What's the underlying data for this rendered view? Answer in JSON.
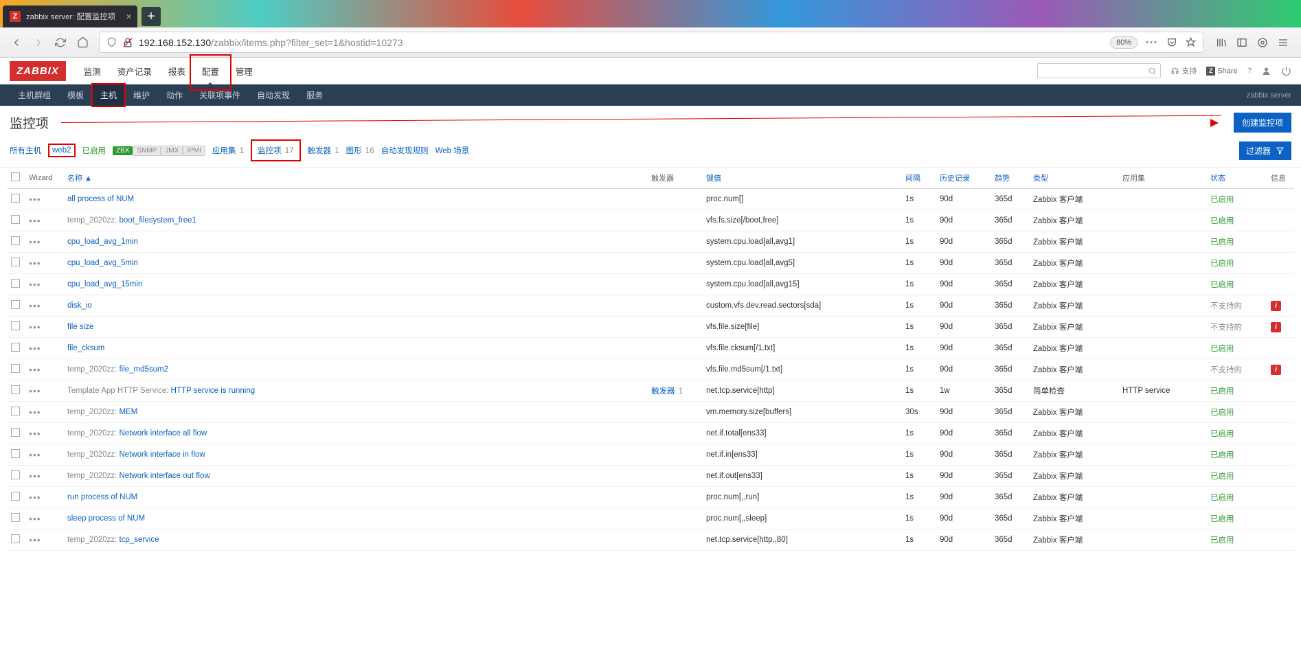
{
  "browser": {
    "tab_title": "zabbix server: 配置监控项",
    "url_host": "192.168.152.130",
    "url_path": "/zabbix/items.php?filter_set=1&hostid=10273",
    "zoom": "80%"
  },
  "header": {
    "logo": "ZABBIX",
    "menu": [
      "监测",
      "资产记录",
      "报表",
      "配置",
      "管理"
    ],
    "active_menu": "配置",
    "support": "支持",
    "share": "Share"
  },
  "subnav": {
    "items": [
      "主机群组",
      "模板",
      "主机",
      "维护",
      "动作",
      "关联项事件",
      "自动发现",
      "服务"
    ],
    "active": "主机",
    "server_label": "zabbix server"
  },
  "page": {
    "title": "监控项",
    "create_btn": "创建监控项",
    "filter_btn": "过滤器"
  },
  "hostbar": {
    "all_hosts": "所有主机",
    "host": "web2",
    "enabled": "已启用",
    "zbx": "ZBX",
    "snmp": "SNMP",
    "jmx": "JMX",
    "ipmi": "IPMI",
    "app": "应用集",
    "app_cnt": "1",
    "items": "监控项",
    "items_cnt": "17",
    "trig": "触发器",
    "trig_cnt": "1",
    "graph": "图形",
    "graph_cnt": "16",
    "disc": "自动发现规则",
    "web": "Web 场景"
  },
  "columns": {
    "wizard": "Wizard",
    "name": "名称 ▲",
    "triggers": "触发器",
    "key": "键值",
    "interval": "间隔",
    "history": "历史记录",
    "trends": "趋势",
    "type": "类型",
    "app": "应用集",
    "status": "状态",
    "info": "信息"
  },
  "status": {
    "enabled": "已启用",
    "unsupported": "不支持的"
  },
  "type": {
    "agent": "Zabbix 客户端",
    "simple": "简单检查"
  },
  "trigger_label": "触发器",
  "rows": [
    {
      "name": "all process of NUM",
      "key": "proc.num[]",
      "int": "1s",
      "hist": "90d",
      "trend": "365d",
      "type": "agent",
      "st": "enabled"
    },
    {
      "prefix": "temp_2020zz:",
      "name": "boot_filesystem_free1",
      "key": "vfs.fs.size[/boot,free]",
      "int": "1s",
      "hist": "90d",
      "trend": "365d",
      "type": "agent",
      "st": "enabled"
    },
    {
      "name": "cpu_load_avg_1min",
      "key": "system.cpu.load[all,avg1]",
      "int": "1s",
      "hist": "90d",
      "trend": "365d",
      "type": "agent",
      "st": "enabled"
    },
    {
      "name": "cpu_load_avg_5min",
      "key": "system.cpu.load[all,avg5]",
      "int": "1s",
      "hist": "90d",
      "trend": "365d",
      "type": "agent",
      "st": "enabled"
    },
    {
      "name": "cpu_load_avg_15min",
      "key": "system.cpu.load[all,avg15]",
      "int": "1s",
      "hist": "90d",
      "trend": "365d",
      "type": "agent",
      "st": "enabled"
    },
    {
      "name": "disk_io",
      "key": "custom.vfs.dev.read.sectors[sda]",
      "int": "1s",
      "hist": "90d",
      "trend": "365d",
      "type": "agent",
      "st": "unsupported",
      "info": true
    },
    {
      "name": "file size",
      "key": "vfs.file.size[file]",
      "int": "1s",
      "hist": "90d",
      "trend": "365d",
      "type": "agent",
      "st": "unsupported",
      "info": true
    },
    {
      "name": "file_cksum",
      "key": "vfs.file.cksum[/1.txt]",
      "int": "1s",
      "hist": "90d",
      "trend": "365d",
      "type": "agent",
      "st": "enabled"
    },
    {
      "prefix": "temp_2020zz:",
      "name": "file_md5sum2",
      "key": "vfs.file.md5sum[/1.txt]",
      "int": "1s",
      "hist": "90d",
      "trend": "365d",
      "type": "agent",
      "st": "unsupported",
      "info": true
    },
    {
      "prefix": "Template App HTTP Service:",
      "name": "HTTP service is running",
      "trig": "1",
      "key": "net.tcp.service[http]",
      "int": "1s",
      "hist": "1w",
      "trend": "365d",
      "type": "simple",
      "app": "HTTP service",
      "st": "enabled"
    },
    {
      "prefix": "temp_2020zz:",
      "name": "MEM",
      "key": "vm.memory.size[buffers]",
      "int": "30s",
      "hist": "90d",
      "trend": "365d",
      "type": "agent",
      "st": "enabled"
    },
    {
      "prefix": "temp_2020zz:",
      "name": "Network interface all flow",
      "key": "net.if.total[ens33]",
      "int": "1s",
      "hist": "90d",
      "trend": "365d",
      "type": "agent",
      "st": "enabled"
    },
    {
      "prefix": "temp_2020zz:",
      "name": "Network interface in flow",
      "key": "net.if.in[ens33]",
      "int": "1s",
      "hist": "90d",
      "trend": "365d",
      "type": "agent",
      "st": "enabled"
    },
    {
      "prefix": "temp_2020zz:",
      "name": "Network interface out flow",
      "key": "net.if.out[ens33]",
      "int": "1s",
      "hist": "90d",
      "trend": "365d",
      "type": "agent",
      "st": "enabled"
    },
    {
      "name": "run process of NUM",
      "key": "proc.num[,,run]",
      "int": "1s",
      "hist": "90d",
      "trend": "365d",
      "type": "agent",
      "st": "enabled"
    },
    {
      "name": "sleep process of NUM",
      "key": "proc.num[,,sleep]",
      "int": "1s",
      "hist": "90d",
      "trend": "365d",
      "type": "agent",
      "st": "enabled"
    },
    {
      "prefix": "temp_2020zz:",
      "name": "tcp_service",
      "key": "net.tcp.service[http,,80]",
      "int": "1s",
      "hist": "90d",
      "trend": "365d",
      "type": "agent",
      "st": "enabled"
    }
  ]
}
